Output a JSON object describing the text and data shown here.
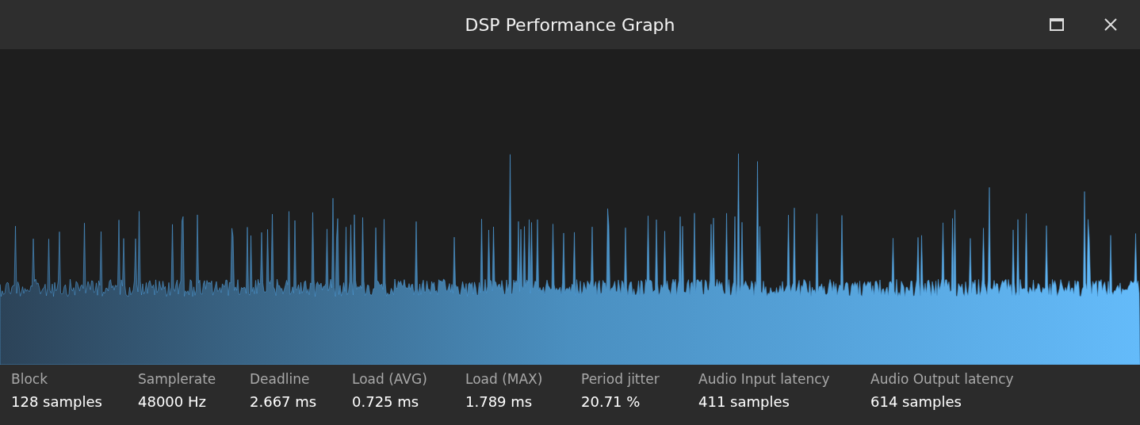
{
  "window": {
    "title": "DSP Performance Graph"
  },
  "stats": [
    {
      "label": "Block",
      "value": "128 samples"
    },
    {
      "label": "Samplerate",
      "value": "48000 Hz"
    },
    {
      "label": "Deadline",
      "value": "2.667 ms"
    },
    {
      "label": "Load (AVG)",
      "value": "0.725 ms"
    },
    {
      "label": "Load (MAX)",
      "value": "1.789 ms"
    },
    {
      "label": "Period jitter",
      "value": "20.71 %"
    },
    {
      "label": "Audio Input latency",
      "value": "411 samples"
    },
    {
      "label": "Audio Output latency",
      "value": "614 samples"
    }
  ]
}
